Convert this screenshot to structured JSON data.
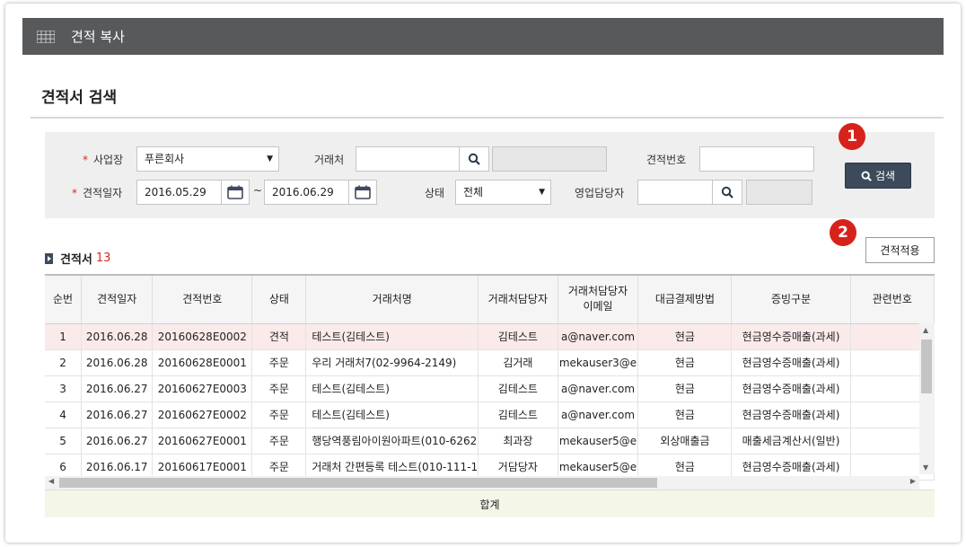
{
  "window": {
    "title": "견적 복사"
  },
  "section": {
    "title": "견적서 검색"
  },
  "search": {
    "business_label": "사업장",
    "business_value": "푸른회사",
    "client_label": "거래처",
    "client_value": "",
    "estimate_no_label": "견적번호",
    "estimate_no_value": "",
    "date_label": "견적일자",
    "date_from": "2016.05.29",
    "date_sep": "~",
    "date_to": "2016.06.29",
    "status_label": "상태",
    "status_value": "전체",
    "sales_rep_label": "영업담당자",
    "sales_rep_value": "",
    "search_button": "검색"
  },
  "badges": {
    "one": "1",
    "two": "2"
  },
  "list": {
    "title": "견적서",
    "count": "13",
    "apply_button": "견적적용",
    "columns": [
      "순번",
      "견적일자",
      "견적번호",
      "상태",
      "거래처명",
      "거래처담당자",
      "거래처담당자\n이메일",
      "대금결제방법",
      "증빙구분",
      "관련번호"
    ],
    "rows": [
      [
        "1",
        "2016.06.28",
        "20160628E0002",
        "견적",
        "테스트(김테스트)",
        "김테스트",
        "a@naver.com",
        "현금",
        "현금영수증매출(과세)",
        ""
      ],
      [
        "2",
        "2016.06.28",
        "20160628E0001",
        "주문",
        "우리 거래처7(02-9964-2149)",
        "김거래",
        "mekauser3@e",
        "현금",
        "현금영수증매출(과세)",
        ""
      ],
      [
        "3",
        "2016.06.27",
        "20160627E0003",
        "주문",
        "테스트(김테스트)",
        "김테스트",
        "a@naver.com",
        "현금",
        "현금영수증매출(과세)",
        ""
      ],
      [
        "4",
        "2016.06.27",
        "20160627E0002",
        "주문",
        "테스트(김테스트)",
        "김테스트",
        "a@naver.com",
        "현금",
        "현금영수증매출(과세)",
        ""
      ],
      [
        "5",
        "2016.06.27",
        "20160627E0001",
        "주문",
        "행당역풍림아이원아파트(010-6262",
        "최과장",
        "mekauser5@e",
        "외상매출금",
        "매출세금계산서(일반)",
        ""
      ],
      [
        "6",
        "2016.06.17",
        "20160617E0001",
        "주문",
        "거래처 간편등록 테스트(010-111-1",
        "거담당자",
        "mekauser5@e",
        "현금",
        "현금영수증매출(과세)",
        ""
      ]
    ],
    "selected_row": 0,
    "summary_label": "합계"
  },
  "colors": {
    "titlebar": "#58595b",
    "search_button": "#3d4a5c",
    "badge": "#d7221b",
    "selected_row": "#fbeaea",
    "summary": "#f4f6e8"
  }
}
